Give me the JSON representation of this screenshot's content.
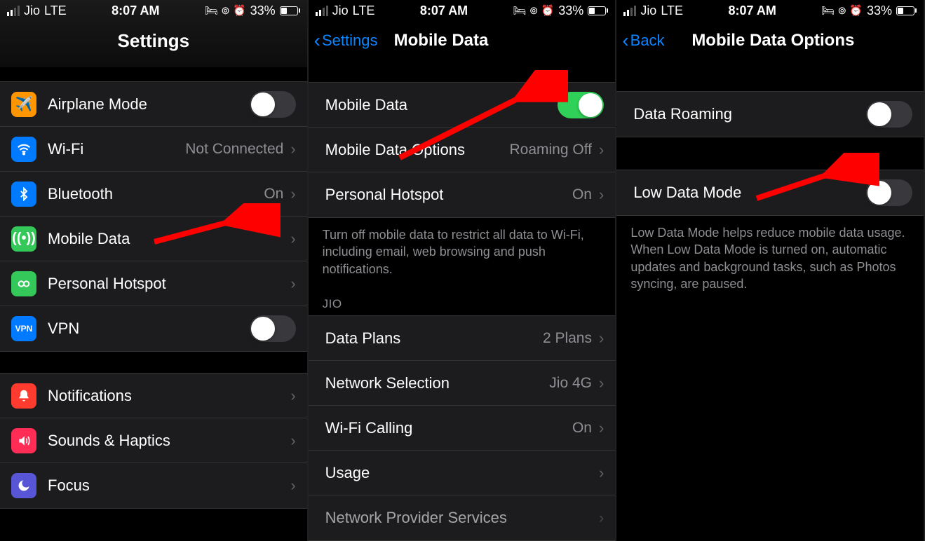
{
  "status": {
    "carrier": "Jio",
    "network": "LTE",
    "time": "8:07 AM",
    "battery_pct": "33%"
  },
  "screen1": {
    "title": "Settings",
    "rows": {
      "airplane": "Airplane Mode",
      "wifi": "Wi-Fi",
      "wifi_value": "Not Connected",
      "bluetooth": "Bluetooth",
      "bluetooth_value": "On",
      "mobile_data": "Mobile Data",
      "hotspot": "Personal Hotspot",
      "vpn": "VPN",
      "notifications": "Notifications",
      "sounds": "Sounds & Haptics",
      "focus": "Focus"
    }
  },
  "screen2": {
    "back": "Settings",
    "title": "Mobile Data",
    "rows": {
      "mobile_data": "Mobile Data",
      "options": "Mobile Data Options",
      "options_value": "Roaming Off",
      "hotspot": "Personal Hotspot",
      "hotspot_value": "On"
    },
    "footer": "Turn off mobile data to restrict all data to Wi-Fi, including email, web browsing and push notifications.",
    "section_header": "JIO",
    "rows2": {
      "data_plans": "Data Plans",
      "data_plans_value": "2 Plans",
      "network_selection": "Network Selection",
      "network_selection_value": "Jio 4G",
      "wifi_calling": "Wi-Fi Calling",
      "wifi_calling_value": "On",
      "usage": "Usage",
      "provider": "Network Provider Services"
    }
  },
  "screen3": {
    "back": "Back",
    "title": "Mobile Data Options",
    "rows": {
      "roaming": "Data Roaming",
      "low_data": "Low Data Mode"
    },
    "footer": "Low Data Mode helps reduce mobile data usage. When Low Data Mode is turned on, automatic updates and background tasks, such as Photos syncing, are paused."
  }
}
